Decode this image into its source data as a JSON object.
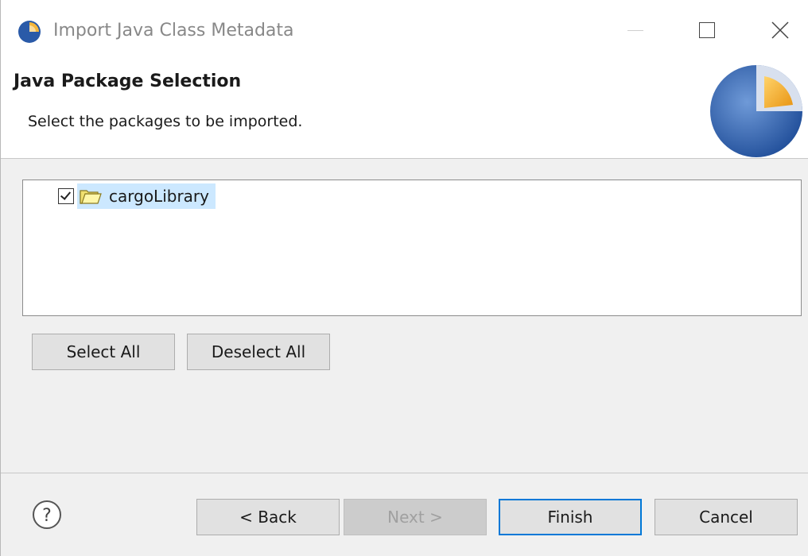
{
  "window": {
    "title": "Import Java Class Metadata"
  },
  "banner": {
    "title": "Java Package Selection",
    "description": "Select the packages to be imported."
  },
  "tree": {
    "items": [
      {
        "label": "cargoLibrary",
        "checked": true,
        "selected": true,
        "icon": "folder-icon"
      }
    ]
  },
  "buttons": {
    "select_all": "Select All",
    "deselect_all": "Deselect All",
    "back": "< Back",
    "next": "Next >",
    "finish": "Finish",
    "cancel": "Cancel"
  },
  "icons": {
    "app": "eclipse-dali-icon",
    "help": "help-icon",
    "minimize": "minimize-icon",
    "maximize": "maximize-icon",
    "close": "close-icon"
  },
  "colors": {
    "selection": "#cce8ff",
    "default_button_border": "#0078d7",
    "logo_blue": "#2a5aa8",
    "logo_orange": "#f0a020"
  }
}
